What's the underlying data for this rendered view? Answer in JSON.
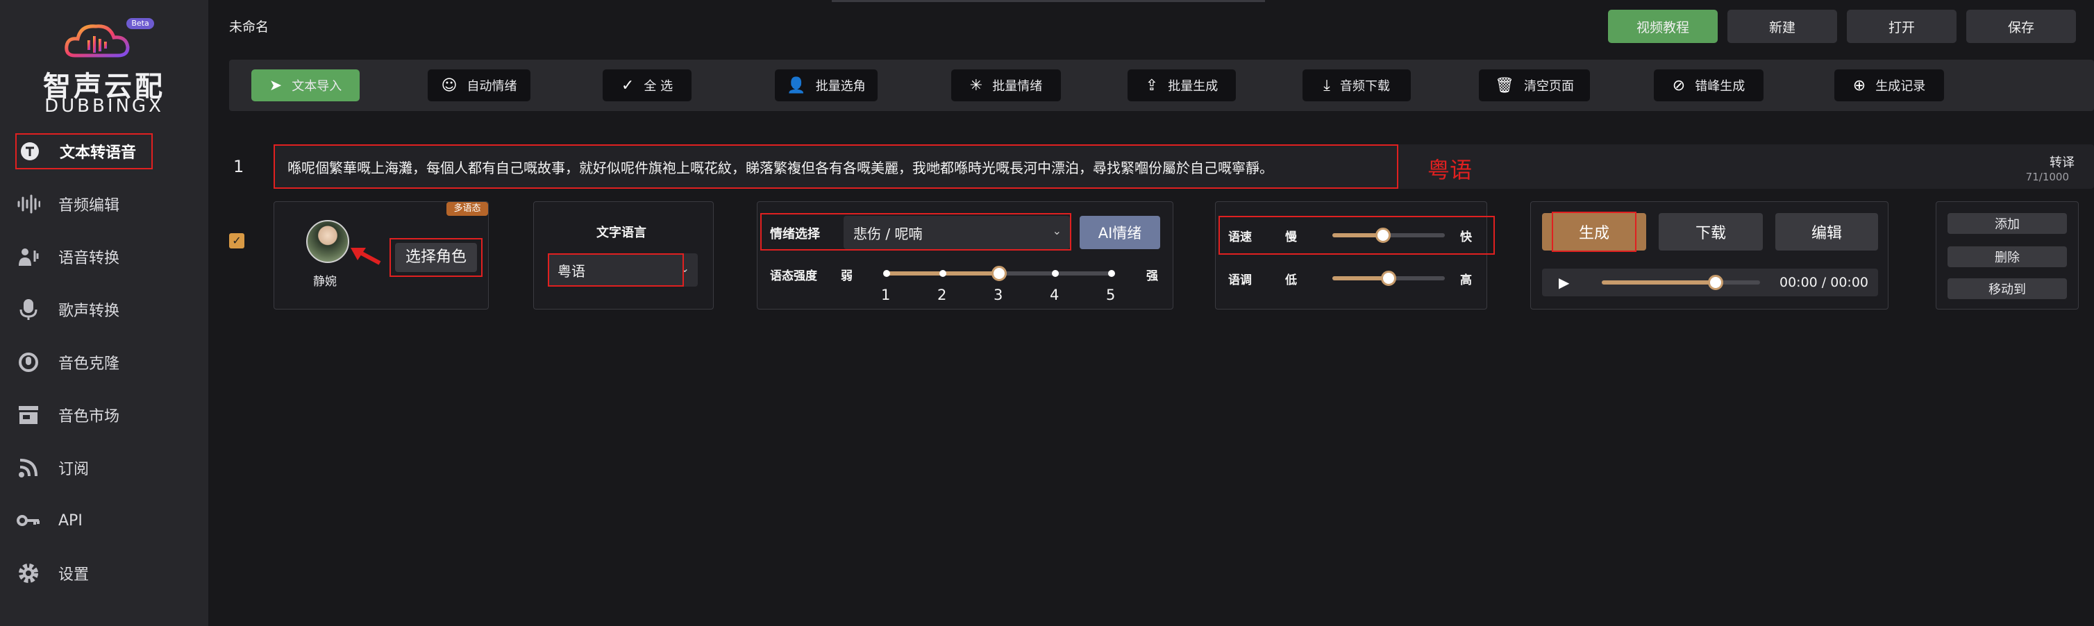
{
  "logo": {
    "beta": "Beta",
    "title": "智声云配",
    "subtitle": "DUBBINGX"
  },
  "sidebar": {
    "items": [
      {
        "label": "文本转语音",
        "icon": "text-to-speech-icon"
      },
      {
        "label": "音频编辑",
        "icon": "audio-wave-icon"
      },
      {
        "label": "语音转换",
        "icon": "voice-convert-icon"
      },
      {
        "label": "歌声转换",
        "icon": "microphone-icon"
      },
      {
        "label": "音色克隆",
        "icon": "voice-clone-icon"
      },
      {
        "label": "音色市场",
        "icon": "store-icon"
      },
      {
        "label": "订阅",
        "icon": "rss-icon"
      },
      {
        "label": "API",
        "icon": "key-icon"
      },
      {
        "label": "设置",
        "icon": "gear-icon"
      }
    ]
  },
  "header": {
    "title": "未命名",
    "buttons": [
      "视频教程",
      "新建",
      "打开",
      "保存"
    ]
  },
  "toolbar": {
    "items": [
      {
        "label": "文本导入",
        "icon": "paper-plane-icon"
      },
      {
        "label": "自动情绪",
        "icon": "smile-icon"
      },
      {
        "label": "全 选",
        "icon": "check-icon"
      },
      {
        "label": "批量选角",
        "icon": "user-icon"
      },
      {
        "label": "批量情绪",
        "icon": "sparkle-icon"
      },
      {
        "label": "批量生成",
        "icon": "upload-icon"
      },
      {
        "label": "音频下载",
        "icon": "download-icon"
      },
      {
        "label": "清空页面",
        "icon": "trash-icon"
      },
      {
        "label": "错峰生成",
        "icon": "compass-icon"
      },
      {
        "label": "生成记录",
        "icon": "history-icon"
      }
    ]
  },
  "row": {
    "index": "1",
    "text": "喺呢個繁華嘅上海灘，每個人都有自己嘅故事，就好似呢件旗袍上嘅花紋，睇落繁複但各有各嘅美麗，我哋都喺時光嘅長河中漂泊，尋找緊嗰份屬於自己嘅寧靜。",
    "lang_note": "粤语",
    "convert_label": "转译",
    "char_count": "71/1000",
    "checked": true,
    "character": {
      "badge": "多语态",
      "name": "静婉",
      "select_button": "选择角色"
    },
    "language": {
      "label": "文字语言",
      "value": "粤语"
    },
    "emotion": {
      "label": "情绪选择",
      "value": "悲伤 / 呢喃",
      "ai_button": "AI情绪",
      "intensity_label": "语态强度",
      "weak": "弱",
      "strong": "强",
      "levels": [
        "1",
        "2",
        "3",
        "4",
        "5"
      ],
      "level_value": 3
    },
    "speed": {
      "label": "语速",
      "min": "慢",
      "max": "快",
      "value": 0.45
    },
    "pitch": {
      "label": "语调",
      "min": "低",
      "max": "高",
      "value": 0.5
    },
    "actions": {
      "generate": "生成",
      "download": "下载",
      "edit": "编辑"
    },
    "player": {
      "time": "00:00 / 00:00",
      "progress": 0.72
    },
    "side_buttons": [
      "添加",
      "删除",
      "移动到"
    ]
  },
  "colors": {
    "accent_green": "#5aa05a",
    "accent_brown": "#a8784a",
    "highlight_red": "#e02020",
    "ai_button": "#6d7a9e"
  }
}
